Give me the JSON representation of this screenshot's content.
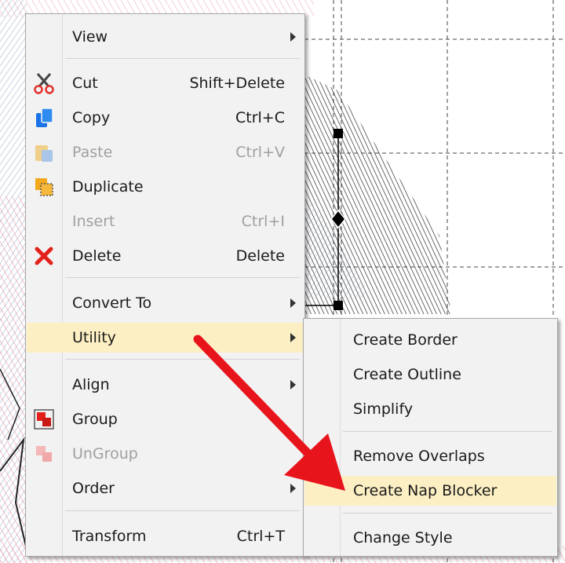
{
  "context_menu": {
    "items": [
      {
        "label": "View",
        "submenu": true
      },
      {
        "label": "Cut",
        "shortcut": "Shift+Delete",
        "icon": "scissors-icon"
      },
      {
        "label": "Copy",
        "shortcut": "Ctrl+C",
        "icon": "copy-icon"
      },
      {
        "label": "Paste",
        "shortcut": "Ctrl+V",
        "icon": "paste-icon",
        "disabled": true
      },
      {
        "label": "Duplicate",
        "icon": "duplicate-icon"
      },
      {
        "label": "Insert",
        "shortcut": "Ctrl+I",
        "disabled": true
      },
      {
        "label": "Delete",
        "shortcut": "Delete",
        "icon": "delete-x-icon"
      },
      {
        "label": "Convert To",
        "submenu": true
      },
      {
        "label": "Utility",
        "submenu": true,
        "highlighted": true
      },
      {
        "label": "Align",
        "submenu": true
      },
      {
        "label": "Group",
        "icon": "group-icon"
      },
      {
        "label": "UnGroup",
        "icon": "ungroup-icon",
        "disabled": true
      },
      {
        "label": "Order",
        "submenu": true
      },
      {
        "label": "Transform",
        "shortcut": "Ctrl+T"
      }
    ]
  },
  "utility_submenu": {
    "items": [
      {
        "label": "Create Border"
      },
      {
        "label": "Create Outline"
      },
      {
        "label": "Simplify"
      },
      {
        "label": "Remove Overlaps"
      },
      {
        "label": "Create Nap Blocker",
        "highlighted": true
      },
      {
        "label": "Change Style"
      }
    ]
  },
  "colors": {
    "highlight": "#fcefc3",
    "menu_bg": "#f2f2f2",
    "arrow": "#e8141c"
  }
}
